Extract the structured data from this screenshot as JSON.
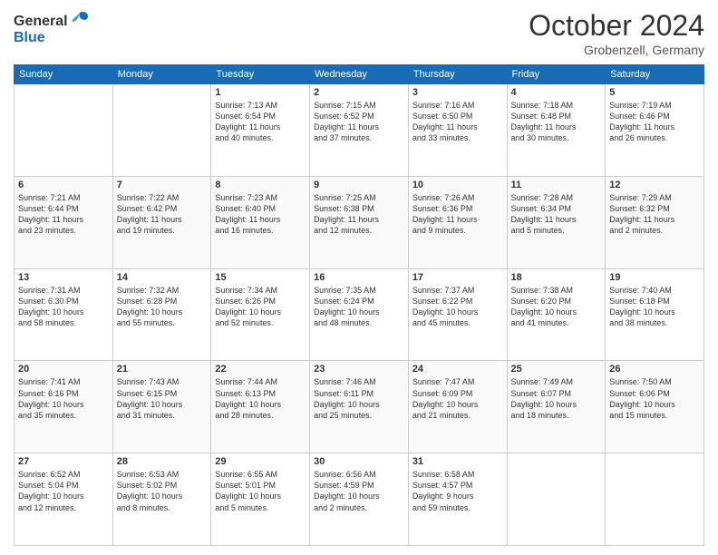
{
  "header": {
    "logo_general": "General",
    "logo_blue": "Blue",
    "month": "October 2024",
    "location": "Grobenzell, Germany"
  },
  "days_of_week": [
    "Sunday",
    "Monday",
    "Tuesday",
    "Wednesday",
    "Thursday",
    "Friday",
    "Saturday"
  ],
  "weeks": [
    [
      {
        "day": "",
        "info": ""
      },
      {
        "day": "",
        "info": ""
      },
      {
        "day": "1",
        "info": "Sunrise: 7:13 AM\nSunset: 6:54 PM\nDaylight: 11 hours\nand 40 minutes."
      },
      {
        "day": "2",
        "info": "Sunrise: 7:15 AM\nSunset: 6:52 PM\nDaylight: 11 hours\nand 37 minutes."
      },
      {
        "day": "3",
        "info": "Sunrise: 7:16 AM\nSunset: 6:50 PM\nDaylight: 11 hours\nand 33 minutes."
      },
      {
        "day": "4",
        "info": "Sunrise: 7:18 AM\nSunset: 6:48 PM\nDaylight: 11 hours\nand 30 minutes."
      },
      {
        "day": "5",
        "info": "Sunrise: 7:19 AM\nSunset: 6:46 PM\nDaylight: 11 hours\nand 26 minutes."
      }
    ],
    [
      {
        "day": "6",
        "info": "Sunrise: 7:21 AM\nSunset: 6:44 PM\nDaylight: 11 hours\nand 23 minutes."
      },
      {
        "day": "7",
        "info": "Sunrise: 7:22 AM\nSunset: 6:42 PM\nDaylight: 11 hours\nand 19 minutes."
      },
      {
        "day": "8",
        "info": "Sunrise: 7:23 AM\nSunset: 6:40 PM\nDaylight: 11 hours\nand 16 minutes."
      },
      {
        "day": "9",
        "info": "Sunrise: 7:25 AM\nSunset: 6:38 PM\nDaylight: 11 hours\nand 12 minutes."
      },
      {
        "day": "10",
        "info": "Sunrise: 7:26 AM\nSunset: 6:36 PM\nDaylight: 11 hours\nand 9 minutes."
      },
      {
        "day": "11",
        "info": "Sunrise: 7:28 AM\nSunset: 6:34 PM\nDaylight: 11 hours\nand 5 minutes."
      },
      {
        "day": "12",
        "info": "Sunrise: 7:29 AM\nSunset: 6:32 PM\nDaylight: 11 hours\nand 2 minutes."
      }
    ],
    [
      {
        "day": "13",
        "info": "Sunrise: 7:31 AM\nSunset: 6:30 PM\nDaylight: 10 hours\nand 58 minutes."
      },
      {
        "day": "14",
        "info": "Sunrise: 7:32 AM\nSunset: 6:28 PM\nDaylight: 10 hours\nand 55 minutes."
      },
      {
        "day": "15",
        "info": "Sunrise: 7:34 AM\nSunset: 6:26 PM\nDaylight: 10 hours\nand 52 minutes."
      },
      {
        "day": "16",
        "info": "Sunrise: 7:35 AM\nSunset: 6:24 PM\nDaylight: 10 hours\nand 48 minutes."
      },
      {
        "day": "17",
        "info": "Sunrise: 7:37 AM\nSunset: 6:22 PM\nDaylight: 10 hours\nand 45 minutes."
      },
      {
        "day": "18",
        "info": "Sunrise: 7:38 AM\nSunset: 6:20 PM\nDaylight: 10 hours\nand 41 minutes."
      },
      {
        "day": "19",
        "info": "Sunrise: 7:40 AM\nSunset: 6:18 PM\nDaylight: 10 hours\nand 38 minutes."
      }
    ],
    [
      {
        "day": "20",
        "info": "Sunrise: 7:41 AM\nSunset: 6:16 PM\nDaylight: 10 hours\nand 35 minutes."
      },
      {
        "day": "21",
        "info": "Sunrise: 7:43 AM\nSunset: 6:15 PM\nDaylight: 10 hours\nand 31 minutes."
      },
      {
        "day": "22",
        "info": "Sunrise: 7:44 AM\nSunset: 6:13 PM\nDaylight: 10 hours\nand 28 minutes."
      },
      {
        "day": "23",
        "info": "Sunrise: 7:46 AM\nSunset: 6:11 PM\nDaylight: 10 hours\nand 25 minutes."
      },
      {
        "day": "24",
        "info": "Sunrise: 7:47 AM\nSunset: 6:09 PM\nDaylight: 10 hours\nand 21 minutes."
      },
      {
        "day": "25",
        "info": "Sunrise: 7:49 AM\nSunset: 6:07 PM\nDaylight: 10 hours\nand 18 minutes."
      },
      {
        "day": "26",
        "info": "Sunrise: 7:50 AM\nSunset: 6:06 PM\nDaylight: 10 hours\nand 15 minutes."
      }
    ],
    [
      {
        "day": "27",
        "info": "Sunrise: 6:52 AM\nSunset: 5:04 PM\nDaylight: 10 hours\nand 12 minutes."
      },
      {
        "day": "28",
        "info": "Sunrise: 6:53 AM\nSunset: 5:02 PM\nDaylight: 10 hours\nand 8 minutes."
      },
      {
        "day": "29",
        "info": "Sunrise: 6:55 AM\nSunset: 5:01 PM\nDaylight: 10 hours\nand 5 minutes."
      },
      {
        "day": "30",
        "info": "Sunrise: 6:56 AM\nSunset: 4:59 PM\nDaylight: 10 hours\nand 2 minutes."
      },
      {
        "day": "31",
        "info": "Sunrise: 6:58 AM\nSunset: 4:57 PM\nDaylight: 9 hours\nand 59 minutes."
      },
      {
        "day": "",
        "info": ""
      },
      {
        "day": "",
        "info": ""
      }
    ]
  ]
}
